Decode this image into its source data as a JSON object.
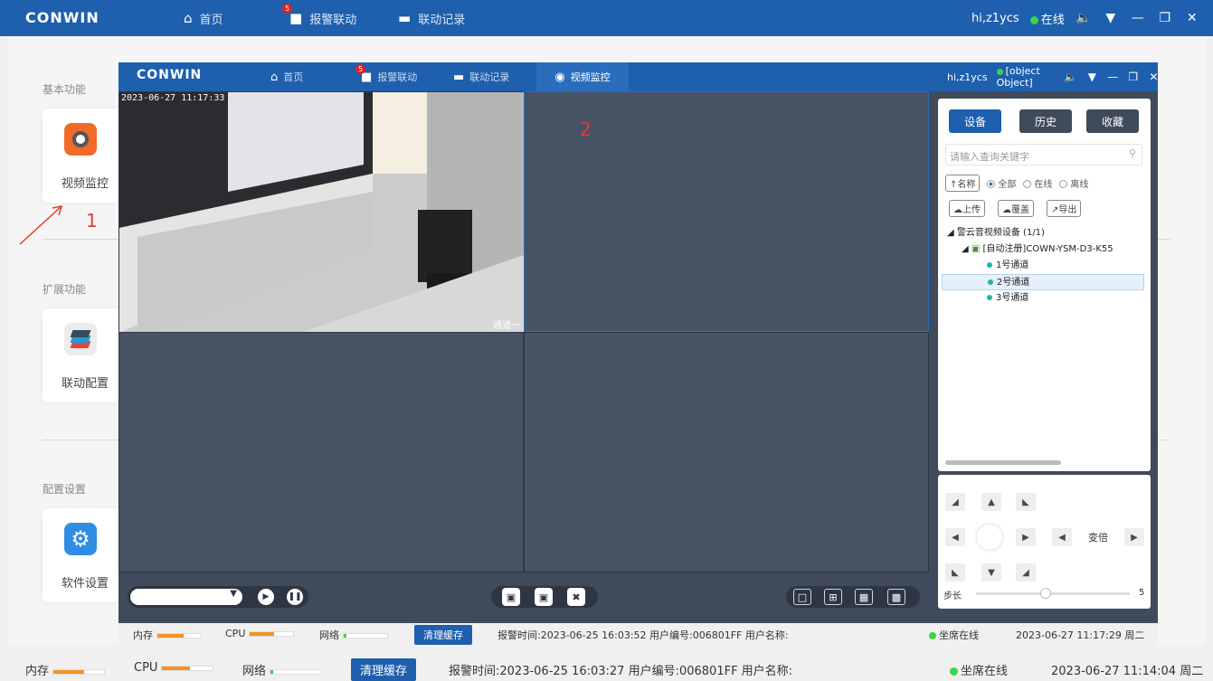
{
  "app": {
    "logo": "CONWIN",
    "nav": [
      {
        "label": "首页",
        "icon": "home-icon"
      },
      {
        "label": "报警联动",
        "icon": "bell-icon",
        "badge": "5"
      },
      {
        "label": "联动记录",
        "icon": "folder-icon"
      }
    ],
    "user": "hi,z1ycs",
    "status": "在线"
  },
  "sidebar": {
    "sections": [
      {
        "label": "基本功能",
        "card": "视频监控"
      },
      {
        "label": "扩展功能",
        "card": "联动配置"
      },
      {
        "label": "配置设置",
        "card": "软件设置"
      }
    ]
  },
  "annotations": {
    "one": "1",
    "two": "2"
  },
  "video_window": {
    "logo": "CONWIN",
    "nav": [
      {
        "label": "首页"
      },
      {
        "label": "报警联动",
        "badge": "5"
      },
      {
        "label": "联动记录"
      },
      {
        "label": "视频监控"
      }
    ],
    "user": "hi,z1ycs",
    "status": {
      "mem": "内存",
      "cpu": "CPU",
      "net": "网络",
      "clear": "清理缓存",
      "alarm": "报警时间:2023-06-25 16:03:52  用户编号:006801FF  用户名称:",
      "seat": "坐席在线",
      "datetime": "2023-06-27 11:17:29 周二"
    },
    "camera": {
      "timestamp": "2023-06-27 11:17:33",
      "channel": "通道一"
    },
    "panel": {
      "tabs": [
        "设备",
        "历史",
        "收藏"
      ],
      "search_placeholder": "请输入查询关键字",
      "sort_label": "↑名称",
      "filters": [
        "全部",
        "在线",
        "离线"
      ],
      "actions": [
        "上传",
        "覆盖",
        "导出"
      ],
      "tree": {
        "root": "警云音视频设备 (1/1)",
        "device": "[自动注册]COWN-YSM-D3-K55",
        "channels": [
          "1号通道",
          "2号通道",
          "3号通道"
        ]
      }
    },
    "ptz": {
      "zoom_label": "变倍",
      "step_label": "步长",
      "step_value": "5",
      "step_fraction": 0.45
    }
  },
  "bottom_status": {
    "mem": "内存",
    "cpu": "CPU",
    "net": "网络",
    "clear": "清理缓存",
    "alarm": "报警时间:2023-06-25 16:03:27  用户编号:006801FF  用户名称:",
    "seat": "坐席在线",
    "datetime": "2023-06-27 11:14:04 周二"
  },
  "colors": {
    "primary": "#1e5fae",
    "meter_mem": "#f39322",
    "meter_net": "#3bd44a",
    "annotation": "#e53935"
  }
}
